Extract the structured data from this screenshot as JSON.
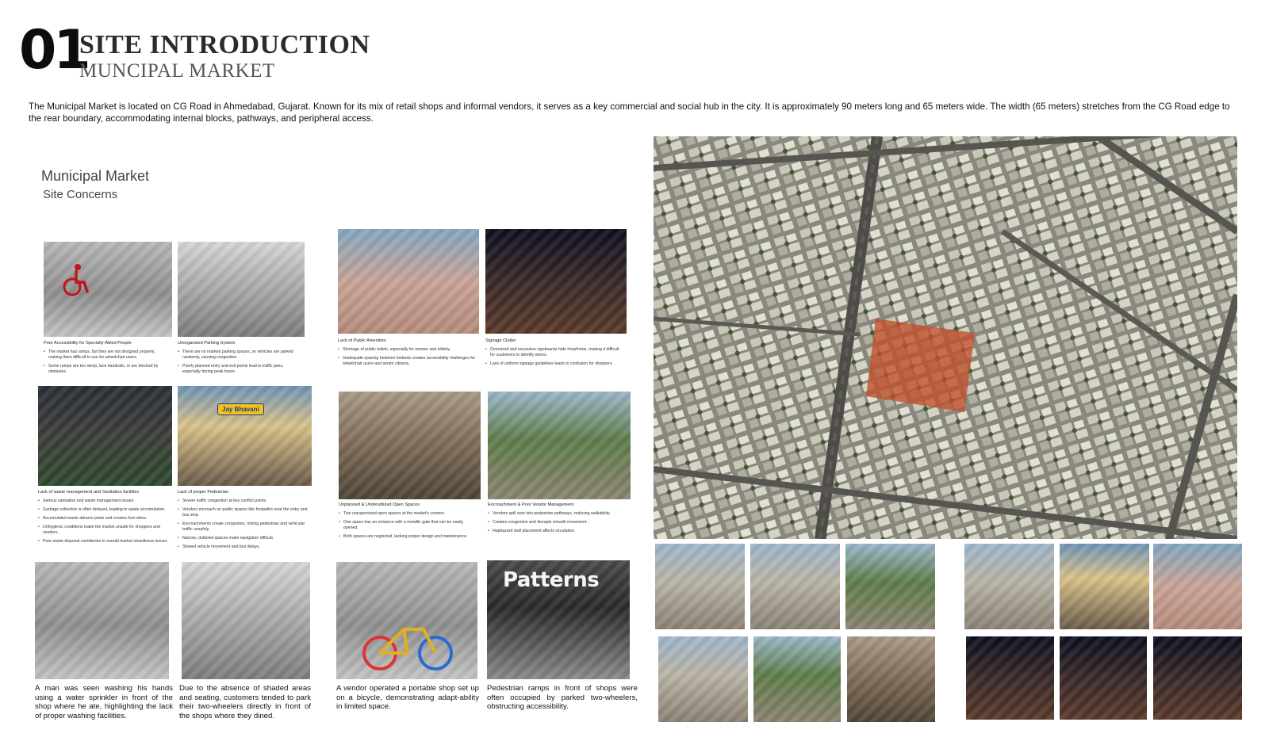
{
  "header": {
    "section_number": "01",
    "title": "SITE INTRODUCTION",
    "subtitle": "MUNCIPAL MARKET",
    "intro": "The Municipal Market is located on CG Road in Ahmedabad, Gujarat. Known for its mix of retail shops and informal vendors, it serves as a key commercial and social hub in the city. It is approximately 90 meters long and 65 meters wide. The width (65 meters) stretches from the CG Road edge to the rear boundary, accommodating internal blocks, pathways, and peripheral access."
  },
  "concerns_panel": {
    "title": "Municipal Market",
    "subtitle": "Site Concerns"
  },
  "concerns": [
    {
      "title": "Poor Accessibility for Specially-Abled People",
      "bullets": [
        "The market has ramps, but they are not designed properly, making them difficult to use for wheelchair users.",
        "Some ramps are too steep, lack handrails, or are blocked by obstacles."
      ]
    },
    {
      "title": "Unorganized Parking System",
      "bullets": [
        "There are no marked parking spaces, so vehicles are parked randomly, causing congestion.",
        "Poorly planned entry and exit points lead to traffic jams, especially during peak hours."
      ]
    },
    {
      "title": "Lack of Public Amenities",
      "bullets": [
        "Shortage of public toilets, especially for women and elderly.",
        "Inadequate spacing between bollards creates accessibility challenges for wheelchair users and senior citizens."
      ]
    },
    {
      "title": "Signage Clutter",
      "bullets": [
        "Oversized and excessive signboards hide shopfronts, making it difficult for customers to identify stores.",
        "Lack of uniform signage guidelines leads to confusion for shoppers."
      ]
    },
    {
      "title": "Lack of waste management and Sanitation facilities",
      "bullets": [
        "Serious sanitation and waste management issues.",
        "Garbage collection is often delayed, leading to waste accumulation.",
        "Accumulated waste attracts pests and creates foul odors.",
        "Unhygienic conditions make the market unsafe for shoppers and vendors.",
        "Poor waste disposal contributes to overall market cleanliness issues."
      ]
    },
    {
      "title": "Lack of proper Pedestrian",
      "bullets": [
        "Severe traffic congestion at key conflict points.",
        "Vendors encroach on public spaces like footpaths near the entry and bus stop.",
        "Encroachments create congestion, mixing pedestrian and vehicular traffic unsafely.",
        "Narrow, cluttered spaces make navigation difficult.",
        "Slowed vehicle movement and bus delays."
      ]
    },
    {
      "title": "Unplanned & Underutilized Open Spaces",
      "bullets": [
        "Two unsupervised open spaces at the market's corners.",
        "One space has an entrance with a metallic gate that can be easily opened.",
        "Both spaces are neglected, lacking proper design and maintenance."
      ]
    },
    {
      "title": "Encroachment & Poor Vendor Management",
      "bullets": [
        "Vendors spill over into pedestrian pathways, reducing walkability.",
        "Creates congestion and disrupts smooth movement.",
        "Haphazard stall placement affects circulation."
      ]
    }
  ],
  "narratives": [
    "A man was seen washing his hands using a water sprinkler in front of the shop where he ate, highlighting the lack of proper washing facilities.",
    "Due to the absence of shaded areas and seating, customers tended to park their two-wheelers directly in front of the shops where they dined.",
    "A vendor operated a portable shop set up on a bicycle, demonstrating adapt-ability in limited space.",
    "Pedestrian ramps in front of shops were often occupied by parked two-wheelers, obstructing accessibility."
  ],
  "photo_signs": {
    "shop_sign": "Patterns",
    "stall_sign": "Jay Bhavani"
  },
  "colors": {
    "site_highlight": "#c0502a",
    "accessibility_icon": "#c0151a"
  }
}
